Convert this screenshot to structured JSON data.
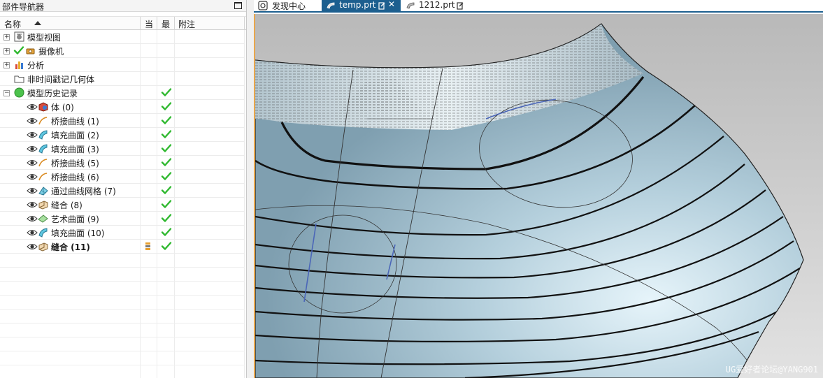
{
  "navigator": {
    "title": "部件导航器",
    "columns": {
      "name": "名称",
      "current": "当",
      "latest": "最",
      "notes": "附注"
    },
    "items": [
      {
        "label": "模型视图",
        "icon": "model-view-icon",
        "bold": false,
        "check": false
      },
      {
        "label": "摄像机",
        "icon": "camera-icon",
        "bold": false,
        "check": false
      },
      {
        "label": "分析",
        "icon": "analysis-icon",
        "bold": false,
        "check": false
      },
      {
        "label": "非时间戳记几何体",
        "icon": "folder-icon",
        "bold": false,
        "check": false
      },
      {
        "label": "模型历史记录",
        "icon": "history-icon",
        "bold": false,
        "check": true
      },
      {
        "label": "体 (0)",
        "icon": "body-icon",
        "bold": false,
        "check": true
      },
      {
        "label": "桥接曲线 (1)",
        "icon": "bridge-curve-icon",
        "bold": false,
        "check": true
      },
      {
        "label": "填充曲面 (2)",
        "icon": "fill-surface-icon",
        "bold": false,
        "check": true
      },
      {
        "label": "填充曲面 (3)",
        "icon": "fill-surface-icon",
        "bold": false,
        "check": true
      },
      {
        "label": "桥接曲线 (5)",
        "icon": "bridge-curve-icon",
        "bold": false,
        "check": true
      },
      {
        "label": "桥接曲线 (6)",
        "icon": "bridge-curve-icon",
        "bold": false,
        "check": true
      },
      {
        "label": "通过曲线网格 (7)",
        "icon": "curve-mesh-icon",
        "bold": false,
        "check": true
      },
      {
        "label": "缝合 (8)",
        "icon": "sew-icon",
        "bold": false,
        "check": true
      },
      {
        "label": "艺术曲面 (9)",
        "icon": "studio-surface-icon",
        "bold": false,
        "check": true
      },
      {
        "label": "填充曲面 (10)",
        "icon": "fill-surface-icon",
        "bold": false,
        "check": true
      },
      {
        "label": "缝合 (11)",
        "icon": "sew-icon",
        "bold": true,
        "check": true
      }
    ]
  },
  "tabs": [
    {
      "label": "发现中心",
      "active": false,
      "icon": "discovery-icon"
    },
    {
      "label": "temp.prt",
      "active": true,
      "icon": "part-icon"
    },
    {
      "label": "1212.prt",
      "active": false,
      "icon": "part-icon"
    }
  ],
  "viewport": {
    "watermark": "UG爱好者论坛@YANG901",
    "surface_color": "#9fbccb",
    "background_color": "#c9c9c9"
  },
  "colors": {
    "accent": "#1c5f8f",
    "check": "#2eb82e"
  }
}
